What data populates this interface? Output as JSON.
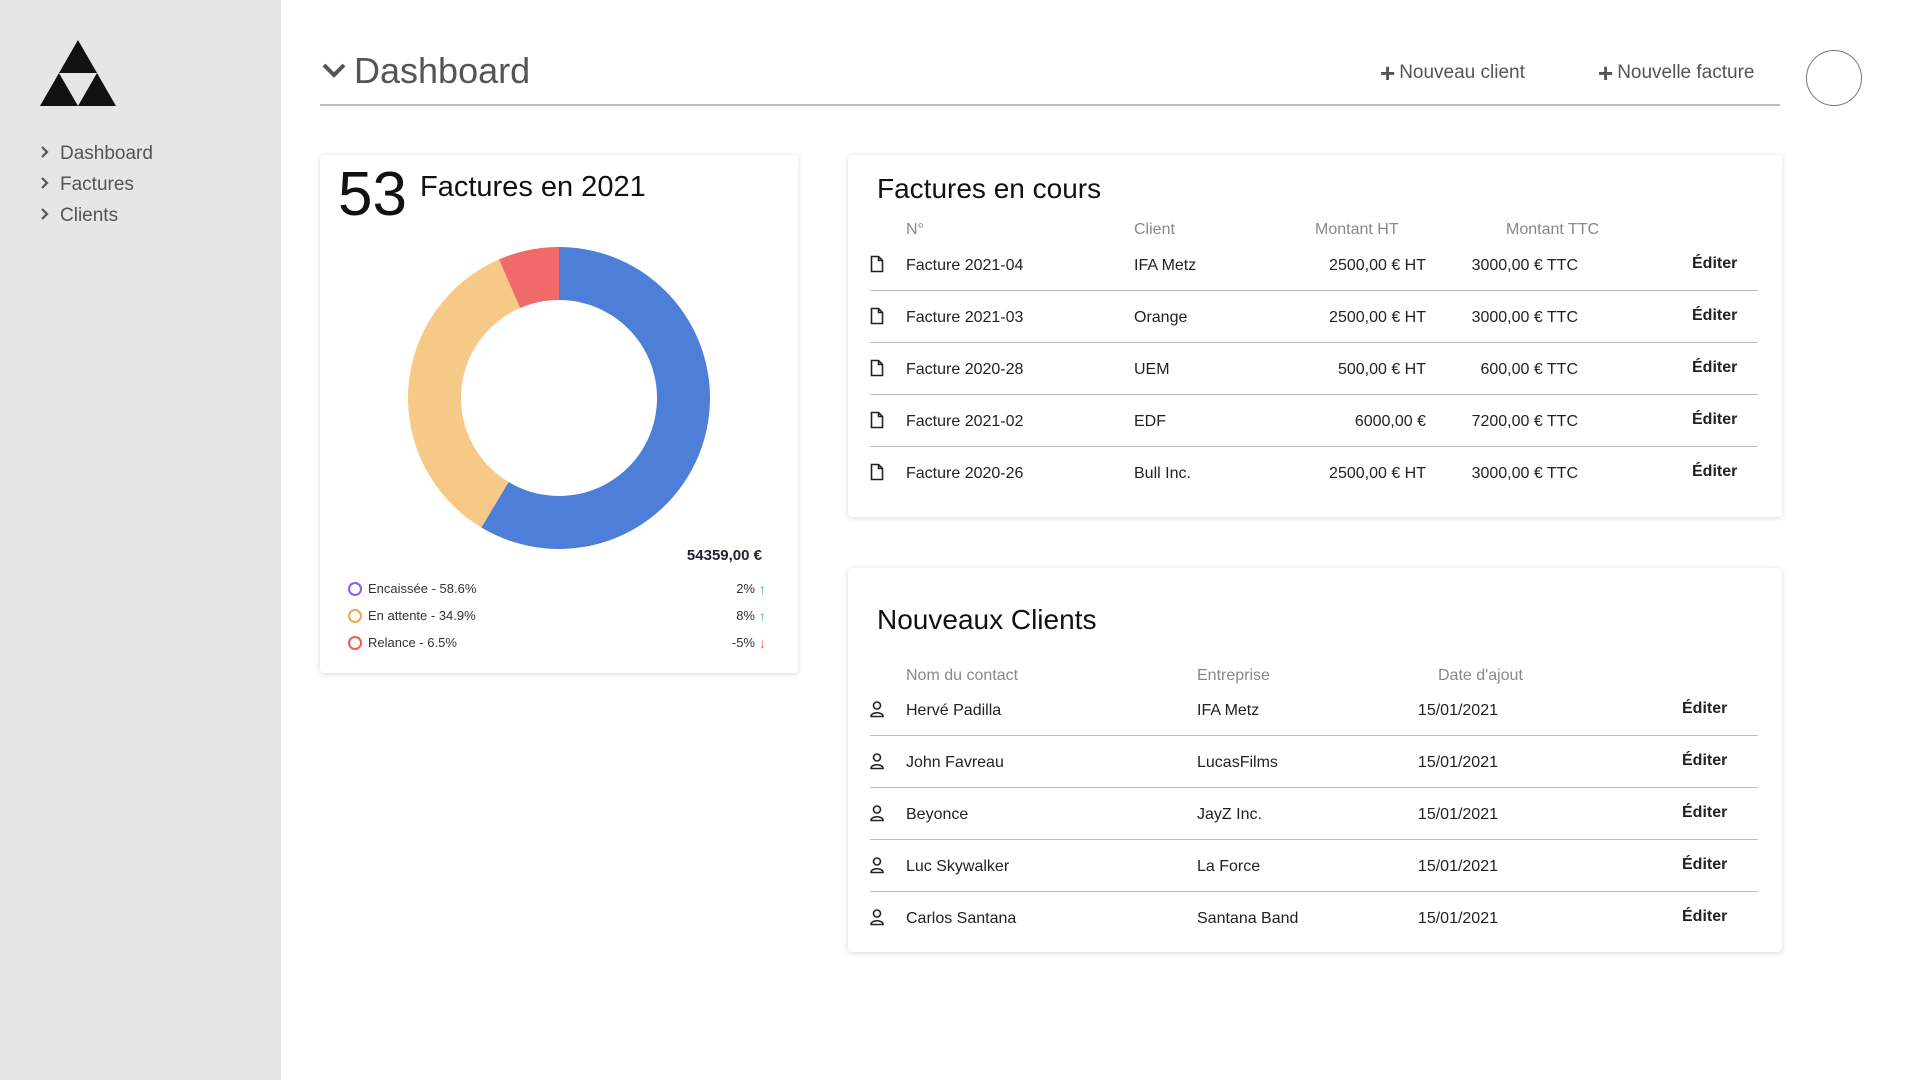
{
  "sidebar": {
    "items": [
      {
        "label": "Dashboard"
      },
      {
        "label": "Factures"
      },
      {
        "label": "Clients"
      }
    ]
  },
  "header": {
    "title": "Dashboard",
    "new_client": "Nouveau client",
    "new_invoice": "Nouvelle facture"
  },
  "stats": {
    "count": "53",
    "label": "Factures en 2021",
    "total": "54359,00 €",
    "legend": [
      {
        "label": "Encaissée - 58.6%",
        "change": "2%",
        "color": "#8a5cf6",
        "trend": "up"
      },
      {
        "label": "En attente - 34.9%",
        "change": "8%",
        "color": "#f5a84a",
        "trend": "up"
      },
      {
        "label": "Relance - 6.5%",
        "change": "-5%",
        "color": "#ef5b5b",
        "trend": "down"
      }
    ],
    "arrow_colors": {
      "up": "#3cbf7c",
      "down": "#ef5b5b"
    },
    "donut": [
      {
        "value": 58.6,
        "color": "#4e7fd8"
      },
      {
        "value": 34.9,
        "color": "#f7c986"
      },
      {
        "value": 6.5,
        "color": "#f06a6a"
      }
    ]
  },
  "invoices": {
    "title": "Factures en cours",
    "headers": {
      "num": "N°",
      "client": "Client",
      "ht": "Montant HT",
      "ttc": "Montant TTC"
    },
    "rows": [
      {
        "num": "Facture 2021-04",
        "client": "IFA Metz",
        "ht": "2500,00 € HT",
        "ttc": "3000,00 € TTC",
        "edit": "Éditer"
      },
      {
        "num": "Facture 2021-03",
        "client": "Orange",
        "ht": "2500,00 € HT",
        "ttc": "3000,00 € TTC",
        "edit": "Éditer"
      },
      {
        "num": "Facture 2020-28",
        "client": "UEM",
        "ht": "500,00 € HT",
        "ttc": "600,00 € TTC",
        "edit": "Éditer"
      },
      {
        "num": "Facture 2021-02",
        "client": "EDF",
        "ht": "6000,00 €",
        "ttc": "7200,00 € TTC",
        "edit": "Éditer"
      },
      {
        "num": "Facture 2020-26",
        "client": "Bull Inc.",
        "ht": "2500,00 € HT",
        "ttc": "3000,00 € TTC",
        "edit": "Éditer"
      }
    ]
  },
  "clients": {
    "title": "Nouveaux Clients",
    "headers": {
      "contact": "Nom du contact",
      "company": "Entreprise",
      "date": "Date d'ajout"
    },
    "rows": [
      {
        "contact": "Hervé Padilla",
        "company": "IFA Metz",
        "date": "15/01/2021",
        "edit": "Éditer"
      },
      {
        "contact": "John Favreau",
        "company": "LucasFilms",
        "date": "15/01/2021",
        "edit": "Éditer"
      },
      {
        "contact": "Beyonce",
        "company": "JayZ Inc.",
        "date": "15/01/2021",
        "edit": "Éditer"
      },
      {
        "contact": "Luc Skywalker",
        "company": "La Force",
        "date": "15/01/2021",
        "edit": "Éditer"
      },
      {
        "contact": "Carlos Santana",
        "company": "Santana Band",
        "date": "15/01/2021",
        "edit": "Éditer"
      }
    ]
  }
}
